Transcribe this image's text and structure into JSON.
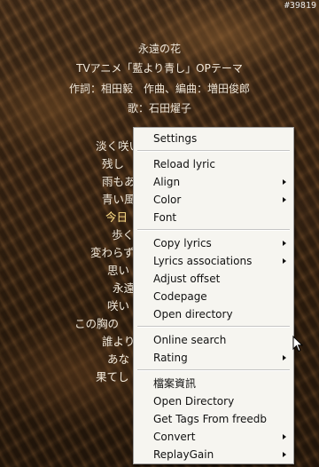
{
  "window_tag": "#39819",
  "song": {
    "title": "永遠の花",
    "subtitle": "TVアニメ「藍より青し」OPテーマ",
    "credits": "作詞：相田毅　作曲、編曲：増田俊郎",
    "singer": "歌：石田燿子"
  },
  "lyrics": [
    "淡く咲い",
    "残し",
    "雨もあ",
    "青い風",
    "今日",
    "歩く",
    "変わらず",
    "思い",
    "永遠",
    "咲い",
    "この胸の",
    "誰より",
    "あな",
    "果てし"
  ],
  "current_lyric_index": 4,
  "context_menu": {
    "groups": [
      [
        {
          "label": "Settings",
          "submenu": false
        }
      ],
      [
        {
          "label": "Reload lyric",
          "submenu": false
        },
        {
          "label": "Align",
          "submenu": true
        },
        {
          "label": "Color",
          "submenu": true
        },
        {
          "label": "Font",
          "submenu": false
        }
      ],
      [
        {
          "label": "Copy lyrics",
          "submenu": true
        },
        {
          "label": "Lyrics associations",
          "submenu": true
        },
        {
          "label": "Adjust offset",
          "submenu": false
        },
        {
          "label": "Codepage",
          "submenu": false
        },
        {
          "label": "Open directory",
          "submenu": false
        }
      ],
      [
        {
          "label": "Online search",
          "submenu": false
        },
        {
          "label": "Rating",
          "submenu": true
        }
      ],
      [
        {
          "label": "檔案資訊",
          "submenu": false
        },
        {
          "label": "Open Directory",
          "submenu": false
        },
        {
          "label": "Get Tags From freedb",
          "submenu": false
        },
        {
          "label": "Convert",
          "submenu": true
        },
        {
          "label": "ReplayGain",
          "submenu": true
        }
      ]
    ]
  },
  "colors": {
    "lyric_text": "#f2eadc",
    "current_lyric": "#ffe089",
    "menu_background": "#f6f5f0"
  }
}
